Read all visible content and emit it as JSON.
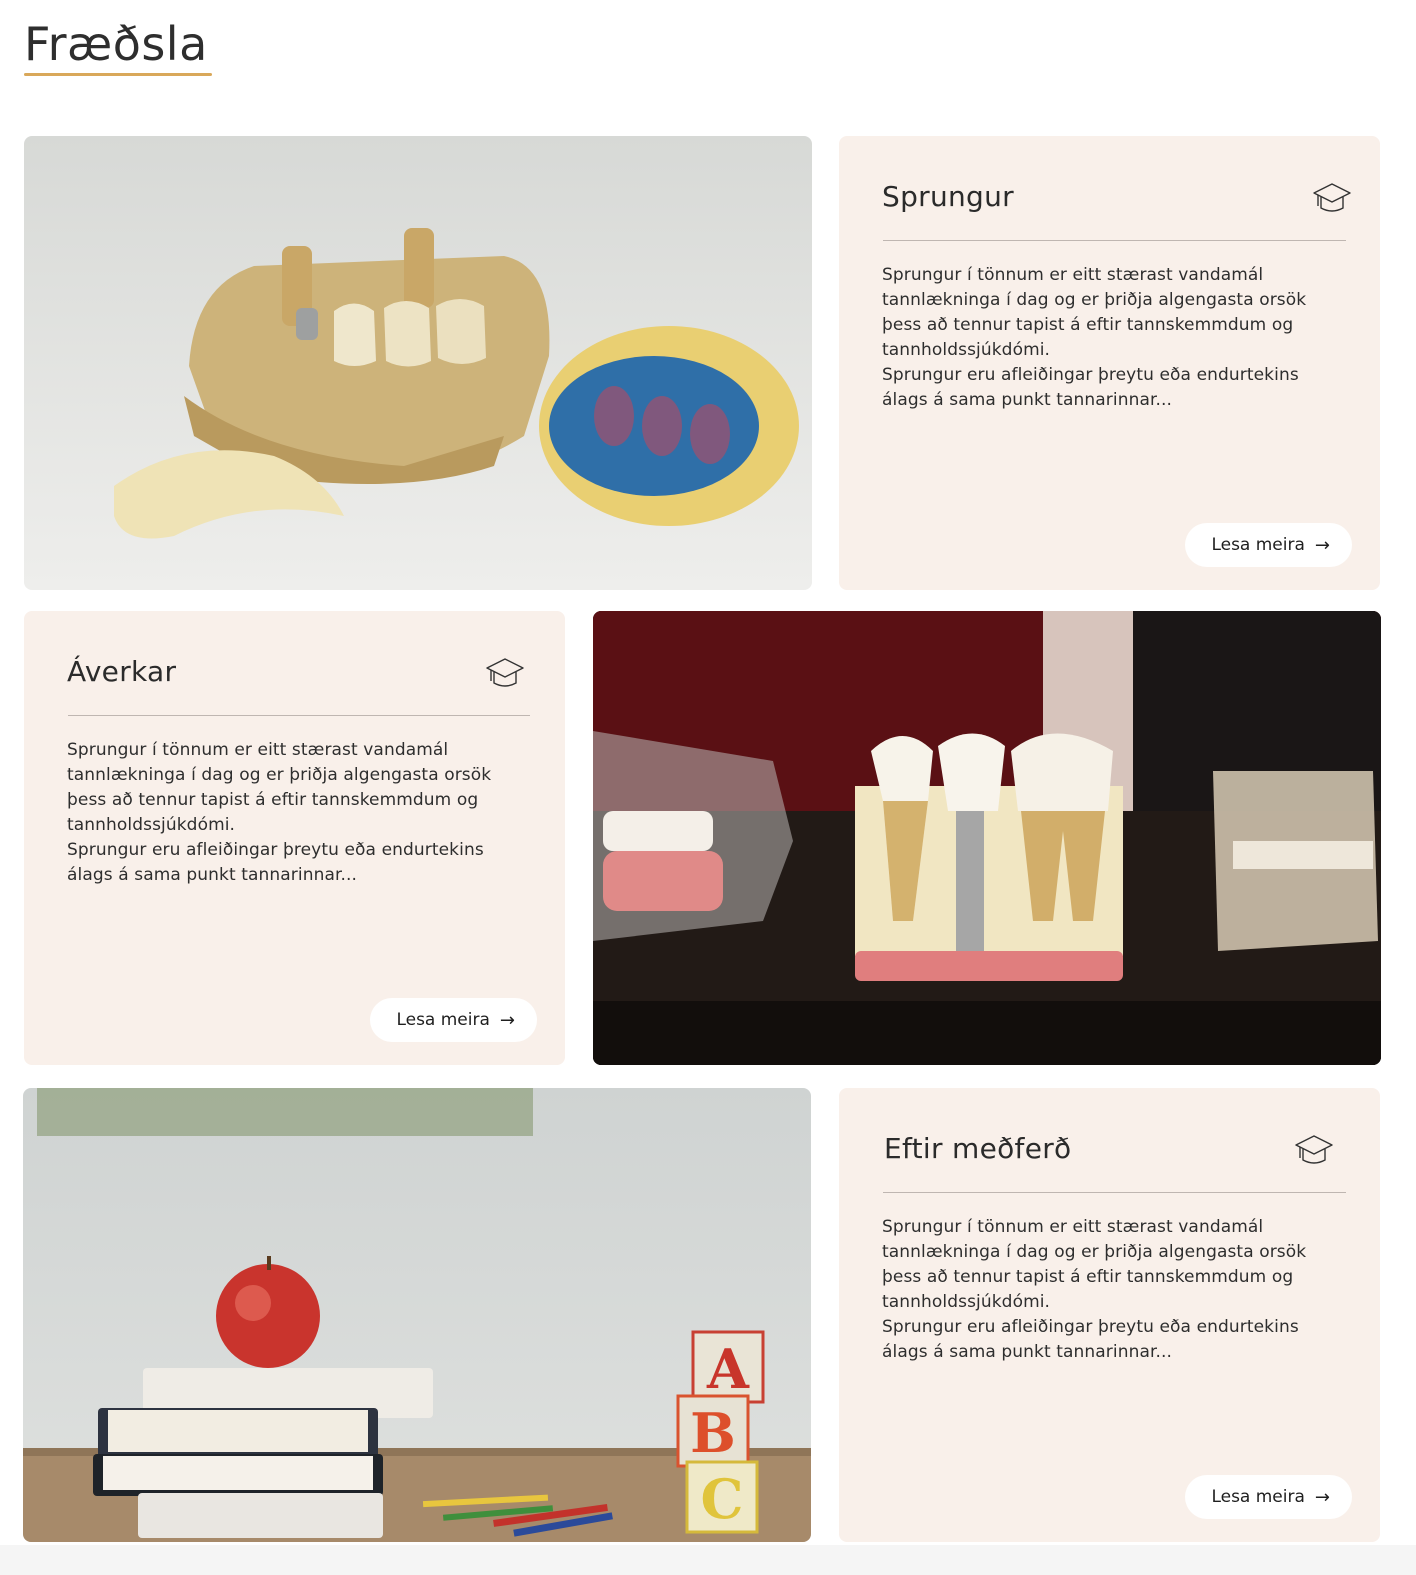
{
  "page": {
    "title": "Fræðsla"
  },
  "colors": {
    "accent": "#d9a85a",
    "card_background": "#f9f0ea"
  },
  "cards": [
    {
      "title": "Sprungur",
      "icon": "graduation-cap-icon",
      "body_lines": [
        "Sprungur í tönnum er eitt stærast vandamál",
        "tannlækninga í dag og er þriðja algengasta orsök",
        "þess að tennur tapist á eftir tannskemmdum og",
        "tannholdssjúkdómi.",
        "Sprungur eru afleiðingar þreytu eða endurtekins",
        "álags á sama punkt tannarinnar..."
      ],
      "button_label": "Lesa meira",
      "button_icon": "arrow-right-icon"
    },
    {
      "title": "Áverkar",
      "icon": "graduation-cap-icon",
      "body_lines": [
        "Sprungur í tönnum er eitt stærast vandamál",
        "tannlækninga í dag og er þriðja algengasta orsök",
        "þess að tennur tapist á eftir tannskemmdum og",
        "tannholdssjúkdómi.",
        "Sprungur eru afleiðingar þreytu eða endurtekins",
        "álags á sama punkt tannarinnar..."
      ],
      "button_label": "Lesa meira",
      "button_icon": "arrow-right-icon"
    },
    {
      "title": "Eftir meðferð",
      "icon": "graduation-cap-icon",
      "body_lines": [
        "Sprungur í tönnum er eitt stærast vandamál",
        "tannlækninga í dag og er þriðja algengasta orsök",
        "þess að tennur tapist á eftir tannskemmdum og",
        "tannholdssjúkdómi.",
        "Sprungur eru afleiðingar þreytu eða endurtekins",
        "álags á sama punkt tannarinnar..."
      ],
      "button_label": "Lesa meira",
      "button_icon": "arrow-right-icon"
    }
  ],
  "photos": [
    {
      "subject": "dental-model-photo"
    },
    {
      "subject": "dental-implant-model-photo"
    },
    {
      "subject": "apple-books-abc-blocks-photo"
    }
  ]
}
